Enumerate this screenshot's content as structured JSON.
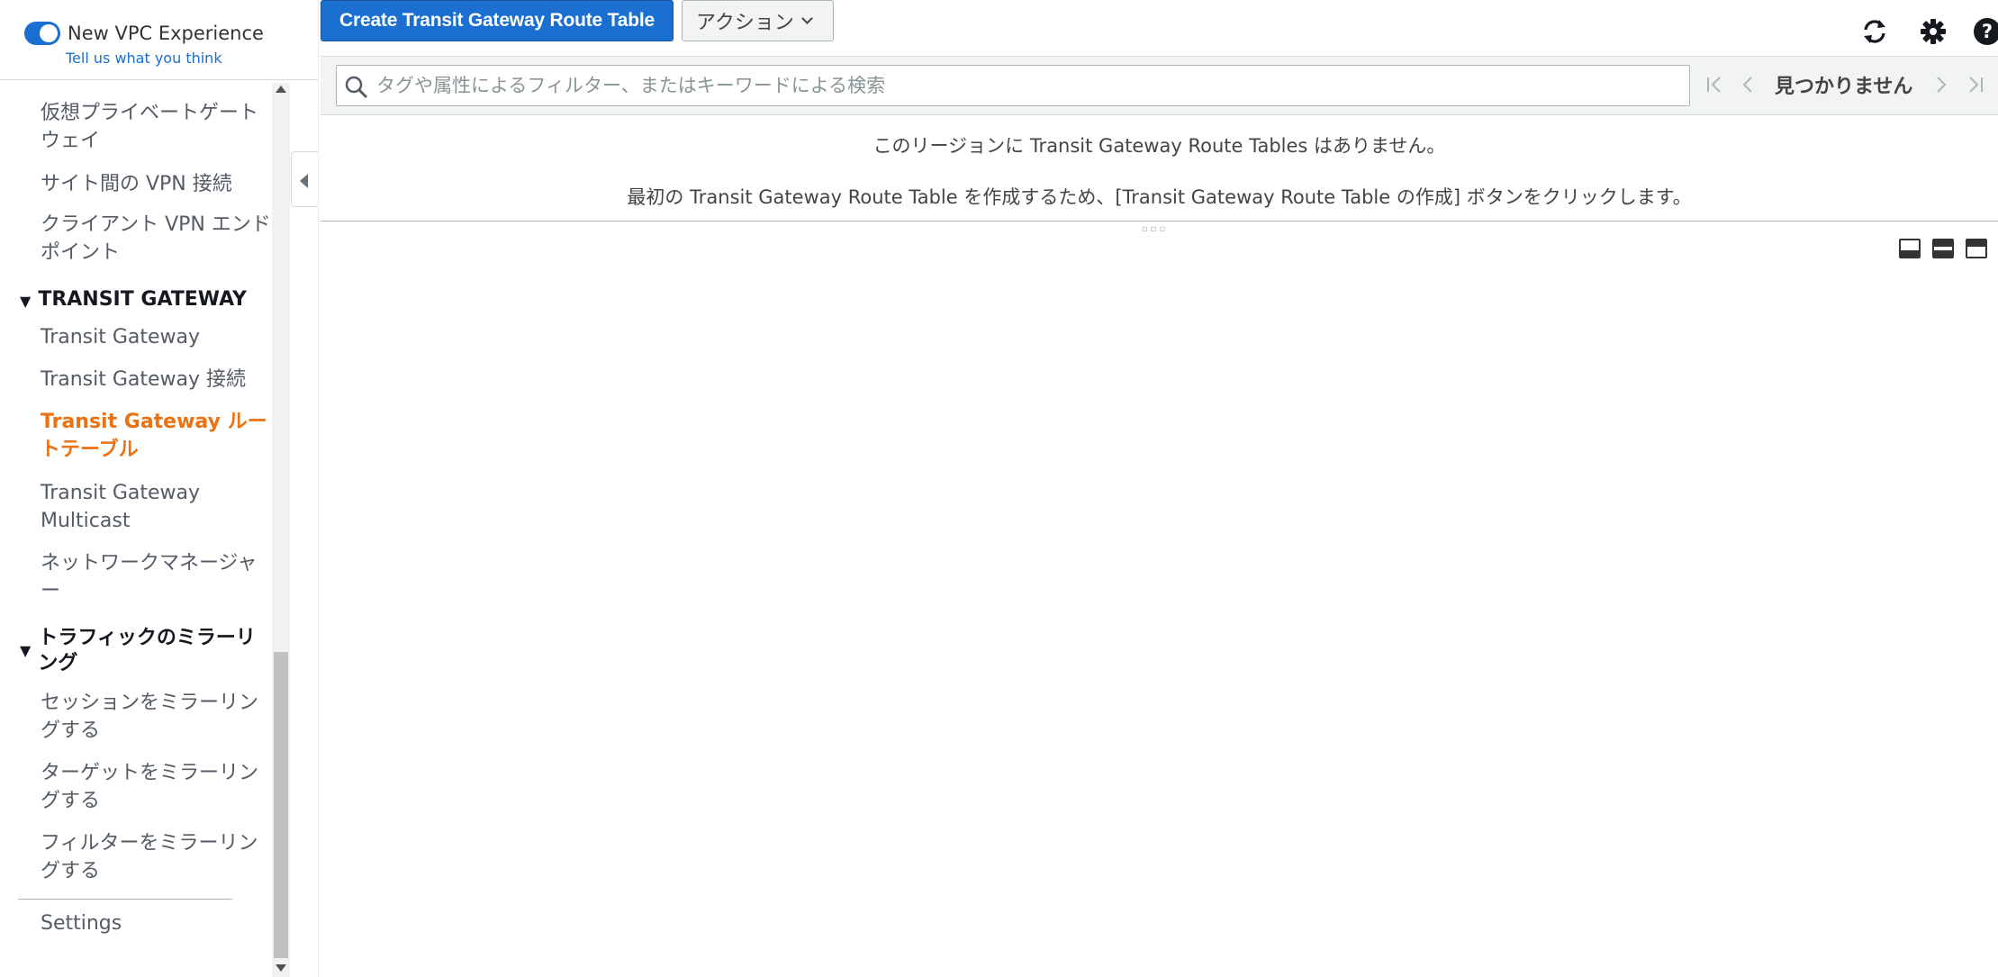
{
  "sidebar": {
    "toggle_label": "New VPC Experience",
    "feedback_link": "Tell us what you think",
    "items": [
      {
        "label": "仮想プライベートゲートウェイ"
      },
      {
        "label": "サイト間の VPN 接続"
      },
      {
        "label": "クライアント VPN エンドポイント"
      }
    ],
    "sections": [
      {
        "title": "TRANSIT GATEWAY",
        "items": [
          {
            "label": "Transit Gateway"
          },
          {
            "label": "Transit Gateway 接続"
          },
          {
            "label": "Transit Gateway ルートテーブル",
            "active": true
          },
          {
            "label": "Transit Gateway Multicast"
          },
          {
            "label": "ネットワークマネージャー"
          }
        ]
      },
      {
        "title": "トラフィックのミラーリング",
        "items": [
          {
            "label": "セッションをミラーリングする"
          },
          {
            "label": "ターゲットをミラーリングする"
          },
          {
            "label": "フィルターをミラーリングする"
          }
        ]
      }
    ],
    "settings_label": "Settings"
  },
  "toolbar": {
    "create_label": "Create Transit Gateway Route Table",
    "actions_label": "アクション"
  },
  "filter": {
    "placeholder": "タグや属性によるフィルター、またはキーワードによる検索",
    "pagination_text": "見つかりません"
  },
  "empty_state": {
    "line1": "このリージョンに Transit Gateway Route Tables はありません。",
    "line2": "最初の Transit Gateway Route Table を作成するため、[Transit Gateway Route Table の作成] ボタンをクリックします。"
  },
  "colors": {
    "primary": "#1a6fd0",
    "active_nav": "#ec7211"
  },
  "icons": [
    "refresh-icon",
    "settings-icon",
    "help-icon",
    "search-icon",
    "first-page-icon",
    "prev-page-icon",
    "next-page-icon",
    "last-page-icon"
  ]
}
